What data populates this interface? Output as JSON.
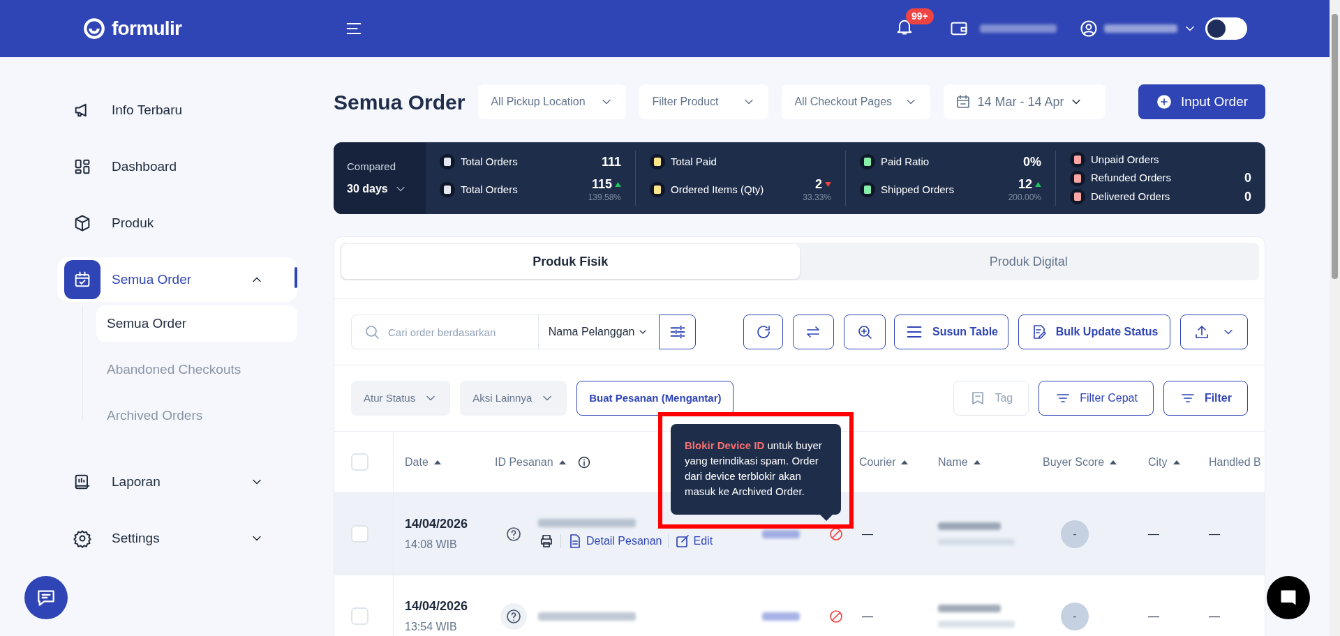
{
  "header": {
    "brand": "formulir",
    "notification_badge": "99+",
    "theme_toggle": {
      "on": false
    }
  },
  "sidebar": {
    "items": [
      {
        "label": "Info Terbaru",
        "selected": false
      },
      {
        "label": "Dashboard",
        "selected": false
      },
      {
        "label": "Produk",
        "selected": false
      },
      {
        "label": "Semua Order",
        "selected": true,
        "expanded": true,
        "children": [
          {
            "label": "Semua Order",
            "selected": true
          },
          {
            "label": "Abandoned Checkouts",
            "selected": false
          },
          {
            "label": "Archived Orders",
            "selected": false
          }
        ]
      },
      {
        "label": "Laporan",
        "selected": false,
        "expanded": false
      },
      {
        "label": "Settings",
        "selected": false,
        "expanded": false
      }
    ]
  },
  "page": {
    "title": "Semua Order",
    "filters": [
      {
        "label": "All Pickup Location"
      },
      {
        "label": "Filter Product"
      },
      {
        "label": "All Checkout Pages"
      }
    ],
    "date_range": "14 Mar - 14 Apr",
    "primary_button": "Input Order"
  },
  "stats": {
    "compared_label": "Compared",
    "period": "30 days",
    "groups": [
      {
        "items": [
          {
            "label": "Total Orders",
            "value": "111"
          },
          {
            "label": "Total Orders",
            "value": "115",
            "increase": true,
            "change": "139.58%"
          }
        ]
      },
      {
        "items": [
          {
            "label": "Total Paid"
          },
          {
            "label": "Ordered Items (Qty)",
            "value": "2",
            "increase": false,
            "change": "33.33%"
          }
        ]
      },
      {
        "items": [
          {
            "label": "Paid Ratio",
            "value": "0%"
          },
          {
            "label": "Shipped Orders",
            "value": "12",
            "increase": true,
            "change": "200.00%"
          }
        ]
      },
      {
        "items": [
          {
            "label": "Unpaid Orders"
          },
          {
            "label": "Refunded Orders",
            "value": "0"
          },
          {
            "label": "Delivered Orders",
            "value": "0"
          }
        ]
      }
    ]
  },
  "tabs": [
    {
      "label": "Produk Fisik",
      "selected": true
    },
    {
      "label": "Produk Digital",
      "selected": false
    }
  ],
  "toolbar": {
    "search_placeholder": "Cari order berdasarkan",
    "search_by": "Nama Pelanggan",
    "buttons": [
      "Susun Table",
      "Bulk Update Status"
    ]
  },
  "actions": {
    "left": [
      {
        "label": "Atur Status",
        "kind": "dropdown"
      },
      {
        "label": "Aksi Lainnya",
        "kind": "dropdown"
      },
      {
        "label": "Buat Pesanan (Mengantar)",
        "kind": "outline"
      }
    ],
    "right": [
      {
        "label": "Tag",
        "disabled": true
      },
      {
        "label": "Filter Cepat",
        "disabled": false
      },
      {
        "label": "Filter",
        "disabled": false
      }
    ]
  },
  "table": {
    "select_all_checked": false,
    "columns": [
      "Date",
      "ID Pesanan",
      "Courier",
      "Name",
      "Buyer Score",
      "City",
      "Handled B"
    ],
    "rows": [
      {
        "checked": false,
        "date": "14/04/2026",
        "time": "14:08 WIB",
        "highlighted": true,
        "links": [
          "Detail Pesanan",
          "Edit"
        ],
        "courier": "—",
        "buyer_score": "-",
        "city": "—",
        "handled_by": "—"
      },
      {
        "checked": false,
        "date": "14/04/2026",
        "time": "13:54 WIB",
        "highlighted": false,
        "courier": "—",
        "buyer_score": "-",
        "city": "—",
        "handled_by": "—"
      }
    ]
  },
  "tooltip": {
    "text": "**Blokir Device ID** untuk buyer yang terindikasi spam. Order dari device terblokir akan masuk ke Archived Order."
  }
}
